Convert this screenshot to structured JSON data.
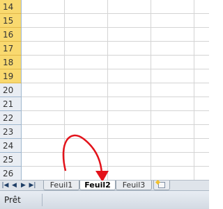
{
  "rows": [
    "14",
    "15",
    "16",
    "17",
    "18",
    "19",
    "20",
    "21",
    "22",
    "23",
    "24",
    "25",
    "26"
  ],
  "selected_rows": [
    "14",
    "15",
    "16",
    "17",
    "18",
    "19"
  ],
  "navigation": {
    "first": "◂|",
    "prev": "◂",
    "next": "▸",
    "last": "▸|"
  },
  "tabs": [
    {
      "label": "Feuil1",
      "active": false
    },
    {
      "label": "Feuil2",
      "active": true
    },
    {
      "label": "Feuil3",
      "active": false
    }
  ],
  "new_sheet_icon": "insert-worksheet-icon",
  "status": {
    "text": "Prêt"
  },
  "colors": {
    "selected_header": "#f9d96f",
    "header": "#e9edf3",
    "arrow": "#e3121a"
  }
}
